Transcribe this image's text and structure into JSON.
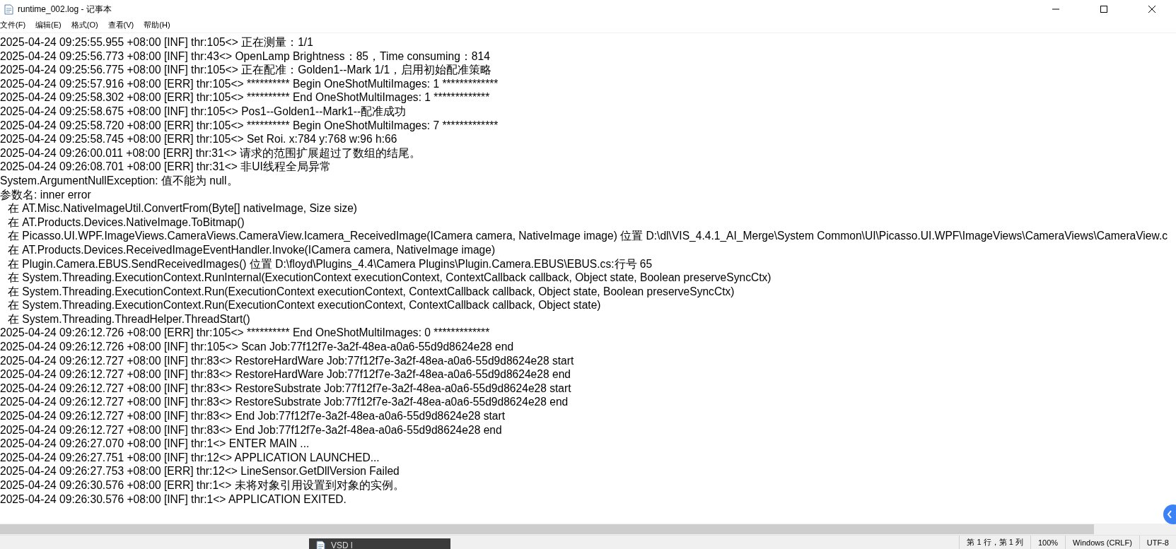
{
  "window": {
    "title": "runtime_002.log - 记事本"
  },
  "menu": [
    {
      "label": "文件(F)"
    },
    {
      "label": "编辑(E)"
    },
    {
      "label": "格式(O)"
    },
    {
      "label": "查看(V)"
    },
    {
      "label": "帮助(H)"
    }
  ],
  "lines": [
    {
      "kind": "log",
      "text": "2025-04-24 09:25:55.955 +08:00 [INF] thr:105<> 正在测量：1/1"
    },
    {
      "kind": "log",
      "text": "2025-04-24 09:25:56.773 +08:00 [INF] thr:43<> OpenLamp Brightness：85，Time consuming：814"
    },
    {
      "kind": "log",
      "text": "2025-04-24 09:25:56.775 +08:00 [INF] thr:105<> 正在配准：Golden1--Mark 1/1，启用初始配准策略"
    },
    {
      "kind": "log",
      "text": "2025-04-24 09:25:57.916 +08:00 [ERR] thr:105<> ********** Begin OneShotMultiImages: 1 *************"
    },
    {
      "kind": "log",
      "text": "2025-04-24 09:25:58.302 +08:00 [ERR] thr:105<> ********** End OneShotMultiImages: 1 *************"
    },
    {
      "kind": "log",
      "text": "2025-04-24 09:25:58.675 +08:00 [INF] thr:105<> Pos1--Golden1--Mark1--配准成功"
    },
    {
      "kind": "log",
      "text": "2025-04-24 09:25:58.720 +08:00 [ERR] thr:105<> ********** Begin OneShotMultiImages: 7 *************"
    },
    {
      "kind": "log",
      "text": "2025-04-24 09:25:58.745 +08:00 [ERR] thr:105<> Set Roi. x:784 y:768 w:96 h:66"
    },
    {
      "kind": "log",
      "text": "2025-04-24 09:26:00.011 +08:00 [ERR] thr:31<> 请求的范围扩展超过了数组的结尾。"
    },
    {
      "kind": "log",
      "text": "2025-04-24 09:26:08.701 +08:00 [ERR] thr:31<> 非UI线程全局异常"
    },
    {
      "kind": "log",
      "text": "System.ArgumentNullException: 值不能为 null。"
    },
    {
      "kind": "log",
      "text": "参数名: inner error"
    },
    {
      "kind": "trace",
      "text": "在 AT.Misc.NativeImageUtil.ConvertFrom(Byte[] nativeImage, Size size)"
    },
    {
      "kind": "trace",
      "text": "在 AT.Products.Devices.NativeImage.ToBitmap()"
    },
    {
      "kind": "trace",
      "text": "在 Picasso.UI.WPF.ImageViews.CameraViews.CameraView.Icamera_ReceivedImage(ICamera camera, NativeImage image) 位置 D:\\dl\\VIS_4.4.1_AI_Merge\\System Common\\UI\\Picasso.UI.WPF\\ImageViews\\CameraViews\\CameraView.c"
    },
    {
      "kind": "trace",
      "text": "在 AT.Products.Devices.ReceivedImageEventHandler.Invoke(ICamera camera, NativeImage image)"
    },
    {
      "kind": "trace",
      "text": "在 Plugin.Camera.EBUS.SendReceivedImages() 位置 D:\\floyd\\Plugins_4.4\\Camera Plugins\\Plugin.Camera.EBUS\\EBUS.cs:行号 65"
    },
    {
      "kind": "trace",
      "text": "在 System.Threading.ExecutionContext.RunInternal(ExecutionContext executionContext, ContextCallback callback, Object state, Boolean preserveSyncCtx)"
    },
    {
      "kind": "trace",
      "text": "在 System.Threading.ExecutionContext.Run(ExecutionContext executionContext, ContextCallback callback, Object state, Boolean preserveSyncCtx)"
    },
    {
      "kind": "trace",
      "text": "在 System.Threading.ExecutionContext.Run(ExecutionContext executionContext, ContextCallback callback, Object state)"
    },
    {
      "kind": "trace",
      "text": "在 System.Threading.ThreadHelper.ThreadStart()"
    },
    {
      "kind": "log",
      "text": "2025-04-24 09:26:12.726 +08:00 [ERR] thr:105<> ********** End OneShotMultiImages: 0 *************"
    },
    {
      "kind": "log",
      "text": "2025-04-24 09:26:12.726 +08:00 [INF] thr:105<> Scan Job:77f12f7e-3a2f-48ea-a0a6-55d9d8624e28 end"
    },
    {
      "kind": "log",
      "text": "2025-04-24 09:26:12.727 +08:00 [INF] thr:83<> RestoreHardWare Job:77f12f7e-3a2f-48ea-a0a6-55d9d8624e28 start"
    },
    {
      "kind": "log",
      "text": "2025-04-24 09:26:12.727 +08:00 [INF] thr:83<> RestoreHardWare Job:77f12f7e-3a2f-48ea-a0a6-55d9d8624e28 end"
    },
    {
      "kind": "log",
      "text": "2025-04-24 09:26:12.727 +08:00 [INF] thr:83<> RestoreSubstrate Job:77f12f7e-3a2f-48ea-a0a6-55d9d8624e28 start"
    },
    {
      "kind": "log",
      "text": "2025-04-24 09:26:12.727 +08:00 [INF] thr:83<> RestoreSubstrate Job:77f12f7e-3a2f-48ea-a0a6-55d9d8624e28 end"
    },
    {
      "kind": "log",
      "text": "2025-04-24 09:26:12.727 +08:00 [INF] thr:83<> End Job:77f12f7e-3a2f-48ea-a0a6-55d9d8624e28 start"
    },
    {
      "kind": "log",
      "text": "2025-04-24 09:26:12.727 +08:00 [INF] thr:83<> End Job:77f12f7e-3a2f-48ea-a0a6-55d9d8624e28 end"
    },
    {
      "kind": "log",
      "text": "2025-04-24 09:26:27.070 +08:00 [INF] thr:1<> ENTER MAIN ..."
    },
    {
      "kind": "log",
      "text": "2025-04-24 09:26:27.751 +08:00 [INF] thr:12<> APPLICATION LAUNCHED..."
    },
    {
      "kind": "log",
      "text": "2025-04-24 09:26:27.753 +08:00 [ERR] thr:12<> LineSensor.GetDllVersion Failed"
    },
    {
      "kind": "log",
      "text": "2025-04-24 09:26:30.576 +08:00 [ERR] thr:1<> 未将对象引用设置到对象的实例。"
    },
    {
      "kind": "log",
      "text": "2025-04-24 09:26:30.576 +08:00 [INF] thr:1<> APPLICATION EXITED."
    }
  ],
  "taskbar_preview": {
    "label": "VSD l"
  },
  "status_bar": [
    {
      "text": "第 1 行，第 1 列"
    },
    {
      "text": "100%"
    },
    {
      "text": "Windows (CRLF)"
    },
    {
      "text": "UTF-8"
    }
  ]
}
